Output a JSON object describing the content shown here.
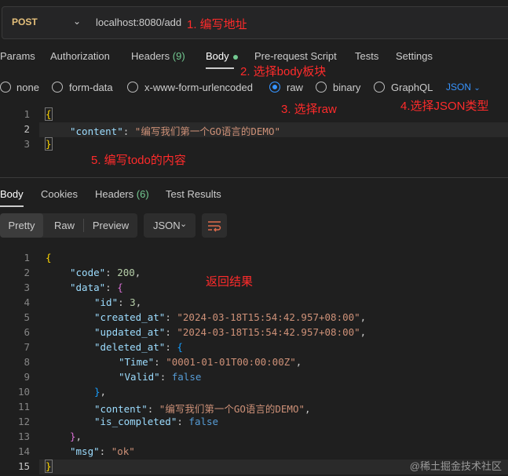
{
  "urlbar": {
    "method": "POST",
    "url": "localhost:8080/add"
  },
  "request_tabs": [
    "Params",
    "Authorization",
    "Headers",
    "Body",
    "Pre-request Script",
    "Tests",
    "Settings"
  ],
  "request_headers_count": "(9)",
  "body_types": [
    "none",
    "form-data",
    "x-www-form-urlencoded",
    "raw",
    "binary",
    "GraphQL"
  ],
  "raw_format": "JSON",
  "request_body": {
    "line_numbers": [
      "1",
      "2",
      "3"
    ],
    "open": "{",
    "key": "\"content\"",
    "colon": ": ",
    "value": "\"编写我们第一个GO语言的DEMO\"",
    "close": "}"
  },
  "response_tabs": [
    "Body",
    "Cookies",
    "Headers",
    "Test Results"
  ],
  "response_headers_count": "(6)",
  "view_modes": [
    "Pretty",
    "Raw",
    "Preview"
  ],
  "response_format": "JSON",
  "response_line_numbers": [
    "1",
    "2",
    "3",
    "4",
    "5",
    "6",
    "7",
    "8",
    "9",
    "10",
    "11",
    "12",
    "13",
    "14",
    "15"
  ],
  "response": {
    "code_key": "\"code\"",
    "code_val": "200",
    "data_key": "\"data\"",
    "id_key": "\"id\"",
    "id_val": "3",
    "created_key": "\"created_at\"",
    "created_val": "\"2024-03-18T15:54:42.957+08:00\"",
    "updated_key": "\"updated_at\"",
    "updated_val": "\"2024-03-18T15:54:42.957+08:00\"",
    "deleted_key": "\"deleted_at\"",
    "time_key": "\"Time\"",
    "time_val": "\"0001-01-01T00:00:00Z\"",
    "valid_key": "\"Valid\"",
    "valid_val": "false",
    "content_key": "\"content\"",
    "content_val": "\"编写我们第一个GO语言的DEMO\"",
    "completed_key": "\"is_completed\"",
    "completed_val": "false",
    "msg_key": "\"msg\"",
    "msg_val": "\"ok\""
  },
  "annotations": {
    "a1": "1. 编写地址",
    "a2": "2. 选择body板块",
    "a3": "3. 选择raw",
    "a4": "4.选择JSON类型",
    "a5": "5. 编写todo的内容",
    "result": "返回结果"
  },
  "watermark": "@稀土掘金技术社区",
  "colors": {
    "method": "#e5c07b",
    "accent": "#3794ff",
    "annotation": "#ff2b2b",
    "success": "#73c991"
  }
}
